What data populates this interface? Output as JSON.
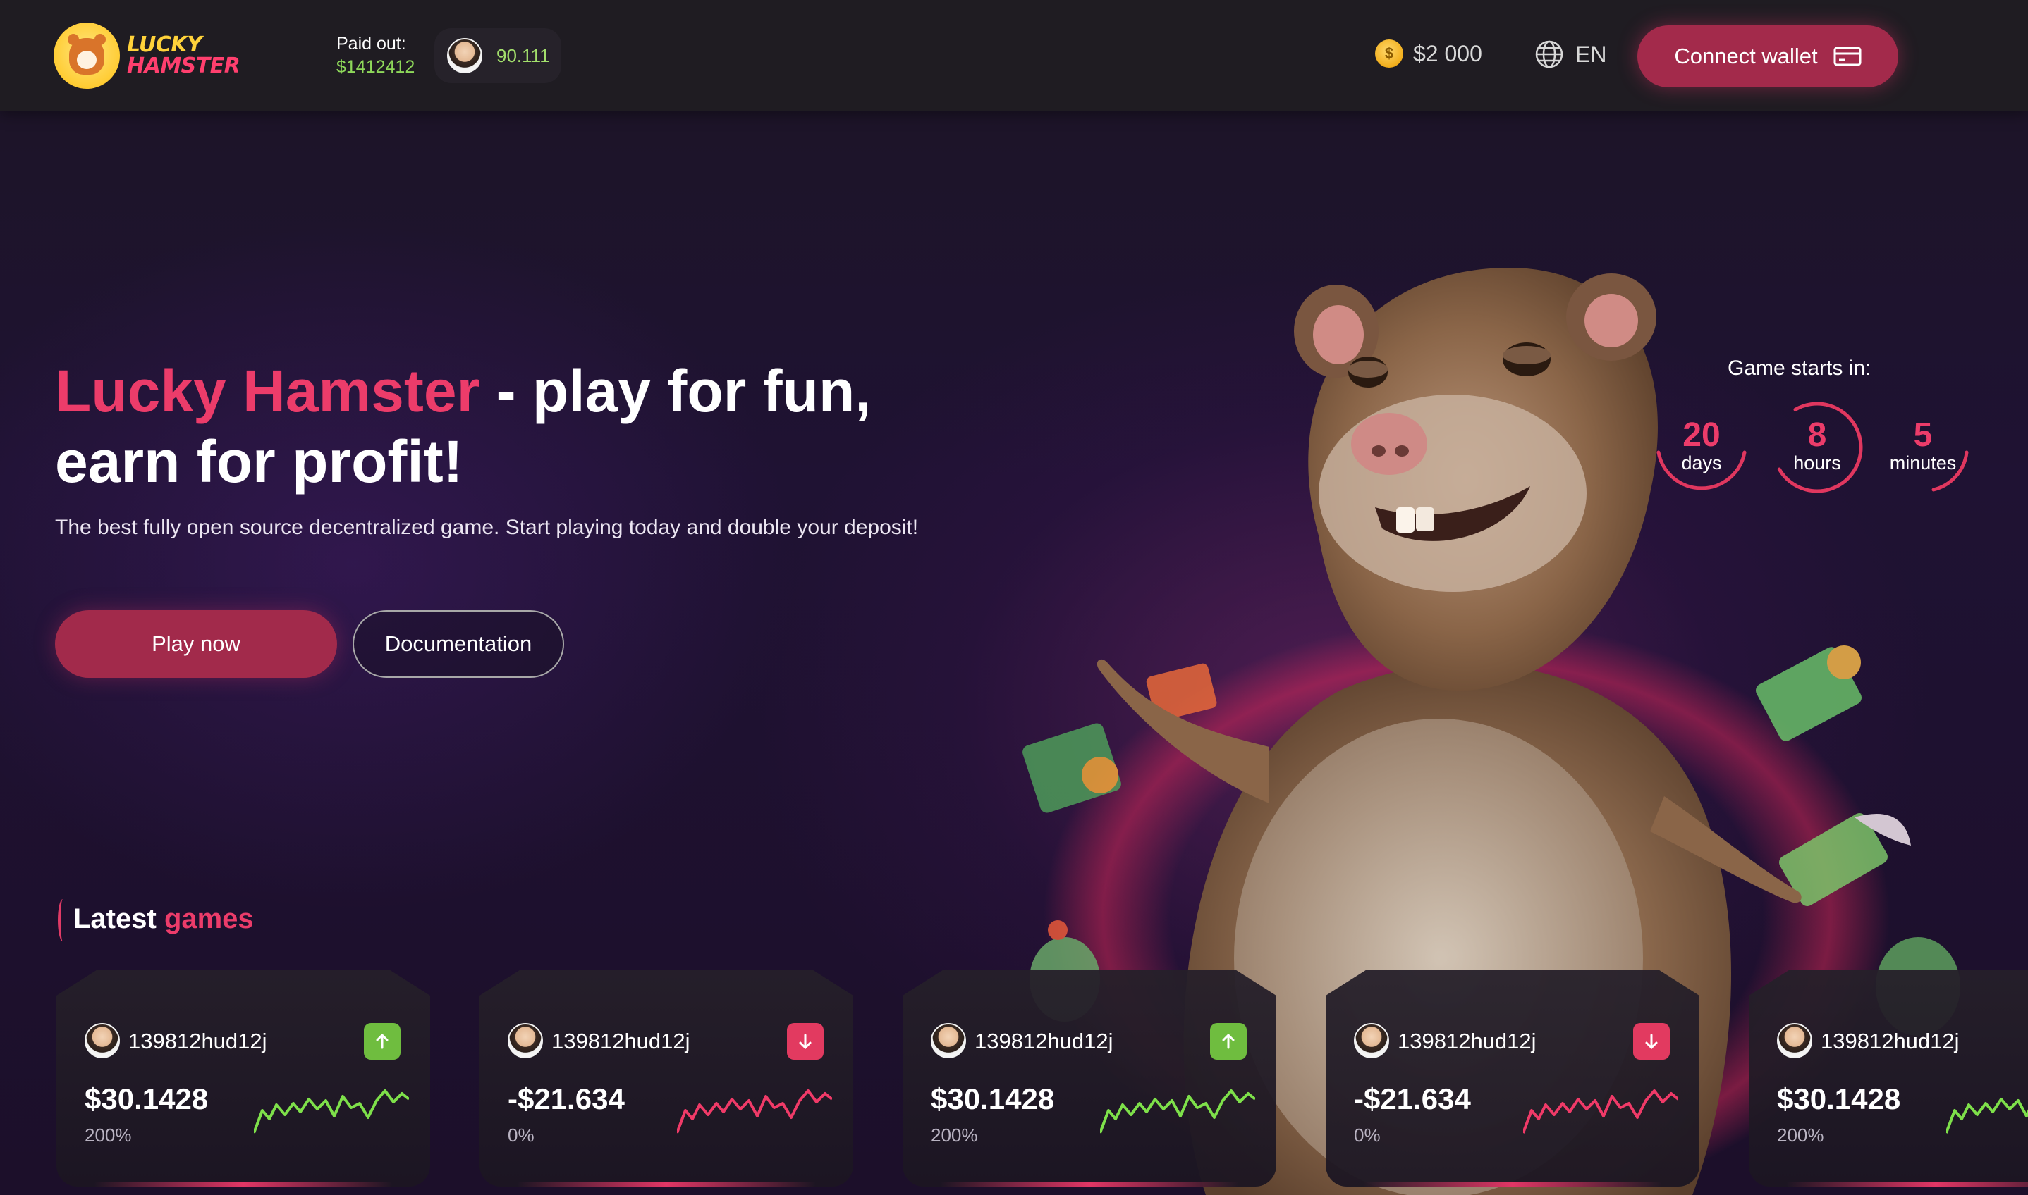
{
  "header": {
    "logo": {
      "line1": "LUCKY",
      "line2": "HAMSTER"
    },
    "paid_out": {
      "label": "Paid out:",
      "value": "$1412412"
    },
    "recent_payout": {
      "amount": "90.111"
    },
    "balance": {
      "icon": "dollar-coin-icon",
      "value": "$2 000"
    },
    "language": {
      "icon": "globe-icon",
      "value": "EN"
    },
    "connect_wallet": {
      "label": "Connect wallet",
      "icon": "wallet-icon"
    }
  },
  "hero": {
    "title_brand": "Lucky Hamster",
    "title_rest": " - play for fun,",
    "title_line2": "earn for profit!",
    "subtitle": "The best fully open source decentralized game. Start playing today and double your deposit!",
    "play_button": "Play now",
    "docs_button": "Documentation"
  },
  "countdown": {
    "label": "Game  starts in:",
    "items": [
      {
        "value": "20",
        "unit": "days"
      },
      {
        "value": "8",
        "unit": "hours"
      },
      {
        "value": "5",
        "unit": "minutes"
      }
    ]
  },
  "latest_games": {
    "title_prefix": "Latest",
    "title_accent": "games",
    "cards": [
      {
        "user": "139812hud12j",
        "amount": "$30.1428",
        "percent": "200%",
        "trend": "up",
        "trend_icon": "arrow-up-icon"
      },
      {
        "user": "139812hud12j",
        "amount": "-$21.634",
        "percent": "0%",
        "trend": "down",
        "trend_icon": "arrow-down-icon"
      },
      {
        "user": "139812hud12j",
        "amount": "$30.1428",
        "percent": "200%",
        "trend": "up",
        "trend_icon": "arrow-up-icon"
      },
      {
        "user": "139812hud12j",
        "amount": "-$21.634",
        "percent": "0%",
        "trend": "down",
        "trend_icon": "arrow-down-icon"
      },
      {
        "user": "139812hud12j",
        "amount": "$30.1428",
        "percent": "200%",
        "trend": "up",
        "trend_icon": "arrow-up-icon"
      }
    ]
  },
  "colors": {
    "accent": "#ec3c6a",
    "button": "#a22a4b",
    "positive": "#8ed85a",
    "negative": "#e23a60",
    "header_bg": "#1f1c22"
  }
}
